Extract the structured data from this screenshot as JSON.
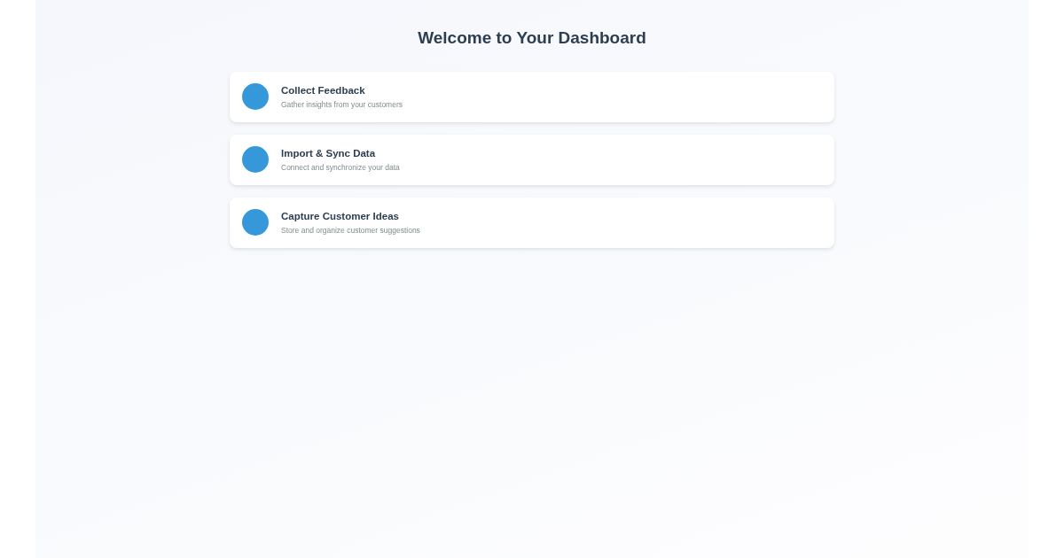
{
  "title": "Welcome to Your Dashboard",
  "cards": [
    {
      "title": "Collect Feedback",
      "description": "Gather insights from your customers"
    },
    {
      "title": "Import & Sync Data",
      "description": "Connect and synchronize your data"
    },
    {
      "title": "Capture Customer Ideas",
      "description": "Store and organize customer suggestions"
    }
  ]
}
